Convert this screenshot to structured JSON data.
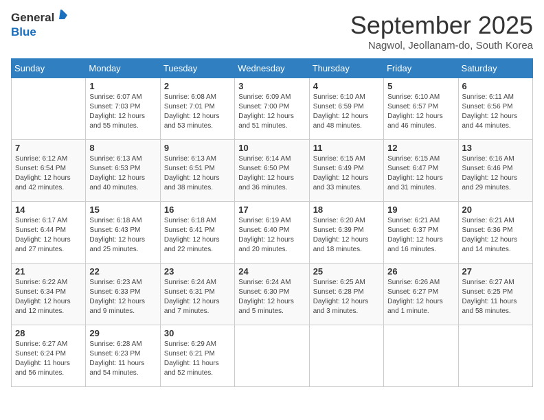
{
  "header": {
    "logo_general": "General",
    "logo_blue": "Blue",
    "month_title": "September 2025",
    "location": "Nagwol, Jeollanam-do, South Korea"
  },
  "days_of_week": [
    "Sunday",
    "Monday",
    "Tuesday",
    "Wednesday",
    "Thursday",
    "Friday",
    "Saturday"
  ],
  "weeks": [
    [
      {
        "day": "",
        "info": ""
      },
      {
        "day": "1",
        "info": "Sunrise: 6:07 AM\nSunset: 7:03 PM\nDaylight: 12 hours\nand 55 minutes."
      },
      {
        "day": "2",
        "info": "Sunrise: 6:08 AM\nSunset: 7:01 PM\nDaylight: 12 hours\nand 53 minutes."
      },
      {
        "day": "3",
        "info": "Sunrise: 6:09 AM\nSunset: 7:00 PM\nDaylight: 12 hours\nand 51 minutes."
      },
      {
        "day": "4",
        "info": "Sunrise: 6:10 AM\nSunset: 6:59 PM\nDaylight: 12 hours\nand 48 minutes."
      },
      {
        "day": "5",
        "info": "Sunrise: 6:10 AM\nSunset: 6:57 PM\nDaylight: 12 hours\nand 46 minutes."
      },
      {
        "day": "6",
        "info": "Sunrise: 6:11 AM\nSunset: 6:56 PM\nDaylight: 12 hours\nand 44 minutes."
      }
    ],
    [
      {
        "day": "7",
        "info": "Sunrise: 6:12 AM\nSunset: 6:54 PM\nDaylight: 12 hours\nand 42 minutes."
      },
      {
        "day": "8",
        "info": "Sunrise: 6:13 AM\nSunset: 6:53 PM\nDaylight: 12 hours\nand 40 minutes."
      },
      {
        "day": "9",
        "info": "Sunrise: 6:13 AM\nSunset: 6:51 PM\nDaylight: 12 hours\nand 38 minutes."
      },
      {
        "day": "10",
        "info": "Sunrise: 6:14 AM\nSunset: 6:50 PM\nDaylight: 12 hours\nand 36 minutes."
      },
      {
        "day": "11",
        "info": "Sunrise: 6:15 AM\nSunset: 6:49 PM\nDaylight: 12 hours\nand 33 minutes."
      },
      {
        "day": "12",
        "info": "Sunrise: 6:15 AM\nSunset: 6:47 PM\nDaylight: 12 hours\nand 31 minutes."
      },
      {
        "day": "13",
        "info": "Sunrise: 6:16 AM\nSunset: 6:46 PM\nDaylight: 12 hours\nand 29 minutes."
      }
    ],
    [
      {
        "day": "14",
        "info": "Sunrise: 6:17 AM\nSunset: 6:44 PM\nDaylight: 12 hours\nand 27 minutes."
      },
      {
        "day": "15",
        "info": "Sunrise: 6:18 AM\nSunset: 6:43 PM\nDaylight: 12 hours\nand 25 minutes."
      },
      {
        "day": "16",
        "info": "Sunrise: 6:18 AM\nSunset: 6:41 PM\nDaylight: 12 hours\nand 22 minutes."
      },
      {
        "day": "17",
        "info": "Sunrise: 6:19 AM\nSunset: 6:40 PM\nDaylight: 12 hours\nand 20 minutes."
      },
      {
        "day": "18",
        "info": "Sunrise: 6:20 AM\nSunset: 6:39 PM\nDaylight: 12 hours\nand 18 minutes."
      },
      {
        "day": "19",
        "info": "Sunrise: 6:21 AM\nSunset: 6:37 PM\nDaylight: 12 hours\nand 16 minutes."
      },
      {
        "day": "20",
        "info": "Sunrise: 6:21 AM\nSunset: 6:36 PM\nDaylight: 12 hours\nand 14 minutes."
      }
    ],
    [
      {
        "day": "21",
        "info": "Sunrise: 6:22 AM\nSunset: 6:34 PM\nDaylight: 12 hours\nand 12 minutes."
      },
      {
        "day": "22",
        "info": "Sunrise: 6:23 AM\nSunset: 6:33 PM\nDaylight: 12 hours\nand 9 minutes."
      },
      {
        "day": "23",
        "info": "Sunrise: 6:24 AM\nSunset: 6:31 PM\nDaylight: 12 hours\nand 7 minutes."
      },
      {
        "day": "24",
        "info": "Sunrise: 6:24 AM\nSunset: 6:30 PM\nDaylight: 12 hours\nand 5 minutes."
      },
      {
        "day": "25",
        "info": "Sunrise: 6:25 AM\nSunset: 6:28 PM\nDaylight: 12 hours\nand 3 minutes."
      },
      {
        "day": "26",
        "info": "Sunrise: 6:26 AM\nSunset: 6:27 PM\nDaylight: 12 hours\nand 1 minute."
      },
      {
        "day": "27",
        "info": "Sunrise: 6:27 AM\nSunset: 6:25 PM\nDaylight: 11 hours\nand 58 minutes."
      }
    ],
    [
      {
        "day": "28",
        "info": "Sunrise: 6:27 AM\nSunset: 6:24 PM\nDaylight: 11 hours\nand 56 minutes."
      },
      {
        "day": "29",
        "info": "Sunrise: 6:28 AM\nSunset: 6:23 PM\nDaylight: 11 hours\nand 54 minutes."
      },
      {
        "day": "30",
        "info": "Sunrise: 6:29 AM\nSunset: 6:21 PM\nDaylight: 11 hours\nand 52 minutes."
      },
      {
        "day": "",
        "info": ""
      },
      {
        "day": "",
        "info": ""
      },
      {
        "day": "",
        "info": ""
      },
      {
        "day": "",
        "info": ""
      }
    ]
  ]
}
